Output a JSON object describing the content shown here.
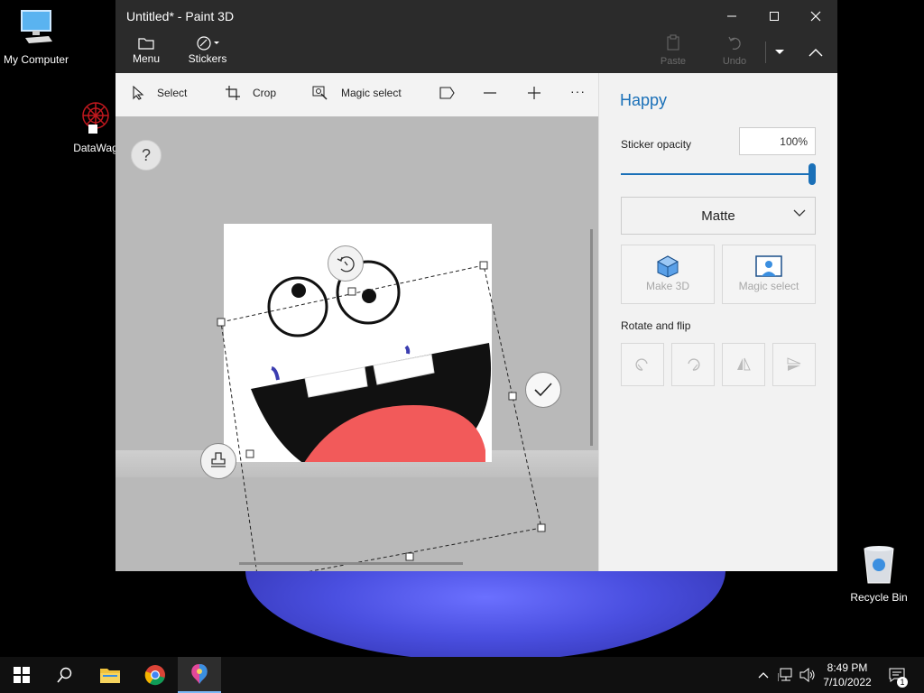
{
  "desktop": {
    "icons": [
      {
        "label": "My Computer"
      },
      {
        "label": "DataWag"
      },
      {
        "label": "Recycle Bin"
      }
    ]
  },
  "window": {
    "title": "Untitled* - Paint 3D",
    "menu_label": "Menu",
    "stickers_label": "Stickers",
    "paste_label": "Paste",
    "undo_label": "Undo"
  },
  "toolbar": {
    "select": "Select",
    "crop": "Crop",
    "magic_select": "Magic select",
    "more": "···"
  },
  "canvas": {
    "help_label": "?"
  },
  "panel": {
    "title": "Happy",
    "opacity_label": "Sticker opacity",
    "opacity_value": "100%",
    "opacity_level": 1.0,
    "finish_selected": "Matte",
    "make3d_label": "Make 3D",
    "magic_select_label": "Magic select",
    "rotate_flip_label": "Rotate and flip"
  },
  "taskbar": {
    "time": "8:49 PM",
    "date": "7/10/2022",
    "notification_count": "1"
  },
  "colors": {
    "accent": "#1a70b8",
    "sticker_tongue": "#f25a5a",
    "titlebar": "#2b2b2b"
  }
}
